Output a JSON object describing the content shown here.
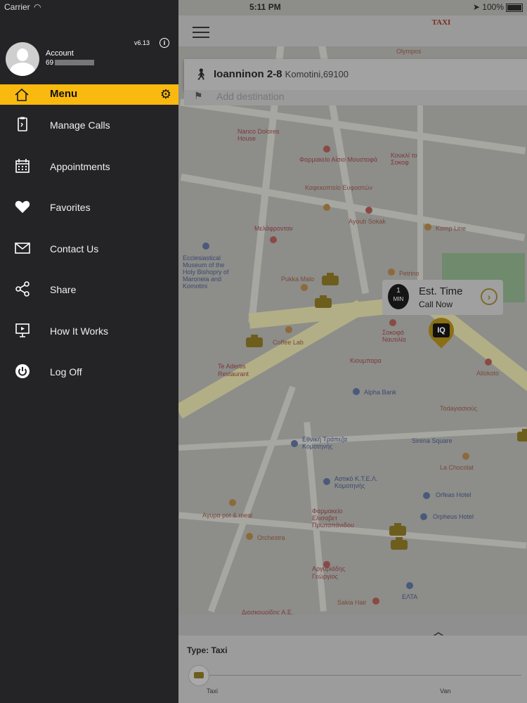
{
  "status_bar": {
    "carrier": "Carrier",
    "time": "5:11 PM",
    "battery": "100%"
  },
  "sidebar": {
    "version": "v6.13",
    "account_label": "Account",
    "account_number": "69",
    "menu_title": "Menu",
    "items": [
      {
        "label": "Manage Calls",
        "icon": "phone-clipboard-icon"
      },
      {
        "label": "Appointments",
        "icon": "calendar-icon"
      },
      {
        "label": "Favorites",
        "icon": "heart-icon"
      },
      {
        "label": "Contact Us",
        "icon": "envelope-icon"
      },
      {
        "label": "Share",
        "icon": "share-icon"
      },
      {
        "label": "How It Works",
        "icon": "presentation-icon"
      },
      {
        "label": "Log Off",
        "icon": "power-icon"
      }
    ],
    "accent_color": "#f9b90f"
  },
  "header": {
    "logo_text": "TAXI"
  },
  "pickup": {
    "street": "Ioanninon 2-8",
    "city": "Komotini,69100"
  },
  "destination": {
    "placeholder": "Add destination"
  },
  "estimate": {
    "minutes": "1",
    "unit": "MIN",
    "title": "Est. Time",
    "subtitle": "Call Now"
  },
  "map_labels": {
    "p1": "Φαρμακείο Αίσιο Μουστοφά",
    "p2": "Καφεκοπτείο Ευφαστών",
    "p3": "Ayoub Sokak",
    "p4": "Komp Line",
    "p5": "Μελάφρονταν",
    "p6": "Ecclesiastical Museum of the Holy Bishopry of Maroneia and Komotini",
    "p7": "Pukka Malo",
    "p8": "Petrino",
    "p9": "Coffee Lab",
    "p10": "Te Adertis Restaurant",
    "p11": "Alpha Bank",
    "p12": "Εθνική Τράπεζα Κομοτηνής",
    "p13": "Αστικό Κ.Τ.Ε.Λ. Κομοτηνής",
    "p14": "Orfeas Hotel",
    "p15": "Orpheus Hotel",
    "p16": "Orchestra",
    "p17": "ΕΛΤΑ",
    "p18": "Αργυριάδης Γεώργιος",
    "p19": "Sirena Square",
    "p20": "La Chocolat",
    "p21": "Allokoto",
    "p22": "Σοκοφά Ναυτιλία",
    "p23": "Φαρμακείο Ελισαβετ Πρωταπάνιδου",
    "p24": "Αγυρα pot & meal",
    "p25": "Sakia Hair",
    "p26": "Διοσκουρίδης Α.Ε.",
    "p27": "Todaγιασιούς",
    "p28": "Κουκλί το Σοκοφ",
    "p29": "Olympos",
    "p30": "Κιουμπαρα",
    "p31": "Nanco Dolores House"
  },
  "bottom_panel": {
    "type_label": "Type: Taxi",
    "option_left": "Taxi",
    "option_right": "Van"
  }
}
